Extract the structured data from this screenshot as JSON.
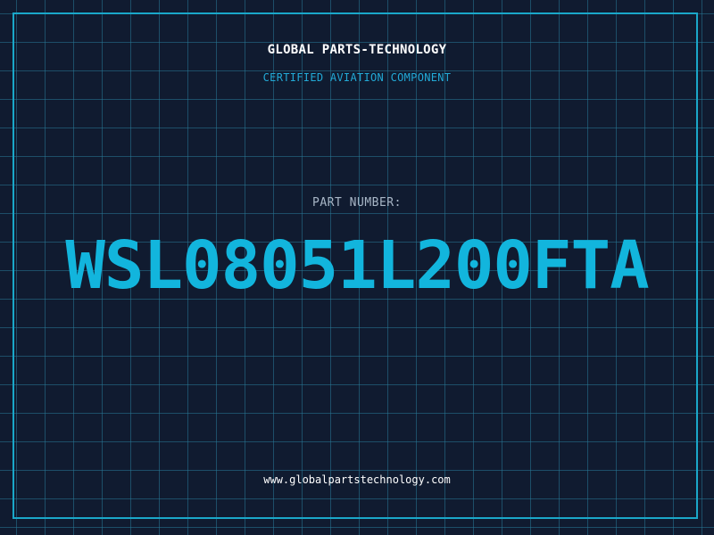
{
  "header": {
    "company": "GLOBAL PARTS-TECHNOLOGY",
    "subtitle": "CERTIFIED AVIATION COMPONENT"
  },
  "part": {
    "label": "PART NUMBER:",
    "number": "WSL08051L200FTA"
  },
  "footer": {
    "url": "www.globalpartstechnology.com"
  },
  "colors": {
    "background": "#101b30",
    "grid": "#28789a",
    "accent": "#12b5dd",
    "frame": "#1aa7c9"
  }
}
